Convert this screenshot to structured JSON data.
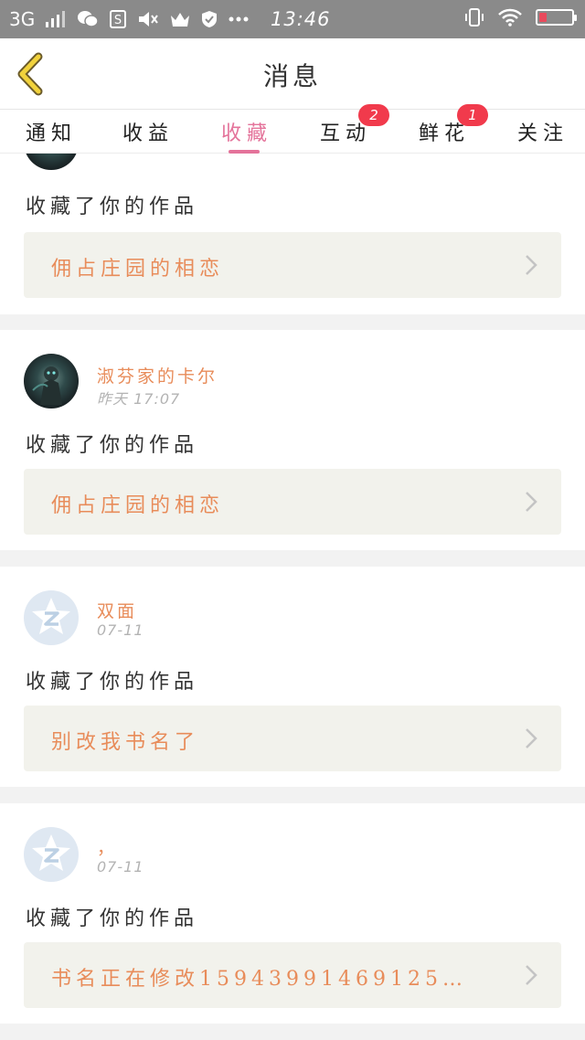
{
  "status_bar": {
    "network": "3G",
    "time": "13:46",
    "icons": [
      "signal-icon",
      "wechat-icon",
      "s-app-icon",
      "mute-icon",
      "crown-icon",
      "shield-icon",
      "more-dots-icon",
      "vibrate-icon",
      "wifi-icon",
      "battery-icon"
    ]
  },
  "header": {
    "title": "消息",
    "back_icon": "back-chevron-icon"
  },
  "tabs": [
    {
      "label": "通知",
      "active": false
    },
    {
      "label": "收益",
      "active": false
    },
    {
      "label": "收藏",
      "active": true
    },
    {
      "label": "互动",
      "active": false,
      "badge": "2"
    },
    {
      "label": "鲜花",
      "active": false,
      "badge": "1"
    },
    {
      "label": "关注",
      "active": false
    }
  ],
  "accent_color": "#e4739a",
  "badge_color": "#f13a4c",
  "name_color": "#e88c5a",
  "cards": [
    {
      "action": "收藏了你的作品",
      "book": "佣占庄园的相恋"
    },
    {
      "username": "淑芬家的卡尔",
      "time": "昨天  17:07",
      "action": "收藏了你的作品",
      "book": "佣占庄园的相恋"
    },
    {
      "username": "双面",
      "time": "07-11",
      "action": "收藏了你的作品",
      "book": "别改我书名了"
    },
    {
      "username": "，",
      "time": "07-11",
      "action": "收藏了你的作品",
      "book": "书名正在修改15943991469125…"
    }
  ]
}
